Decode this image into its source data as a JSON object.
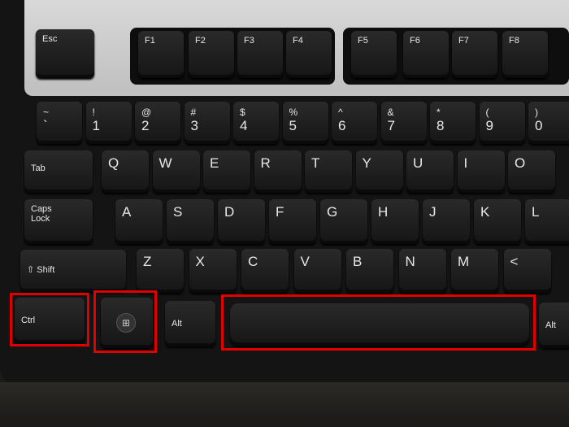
{
  "keyboard": {
    "esc": "Esc",
    "function_keys": [
      "F1",
      "F2",
      "F3",
      "F4",
      "F5",
      "F6",
      "F7",
      "F8"
    ],
    "number_row": [
      {
        "top": "~",
        "bottom": "`"
      },
      {
        "top": "!",
        "bottom": "1"
      },
      {
        "top": "@",
        "bottom": "2"
      },
      {
        "top": "#",
        "bottom": "3"
      },
      {
        "top": "$",
        "bottom": "4"
      },
      {
        "top": "%",
        "bottom": "5"
      },
      {
        "top": "^",
        "bottom": "6"
      },
      {
        "top": "&",
        "bottom": "7"
      },
      {
        "top": "*",
        "bottom": "8"
      },
      {
        "top": "(",
        "bottom": "9"
      },
      {
        "top": ")",
        "bottom": "0"
      }
    ],
    "tab": "Tab",
    "top_row": [
      "Q",
      "W",
      "E",
      "R",
      "T",
      "Y",
      "U",
      "I",
      "O"
    ],
    "caps": "Caps Lock",
    "home_row": [
      "A",
      "S",
      "D",
      "F",
      "G",
      "H",
      "J",
      "K",
      "L"
    ],
    "shift": "Shift",
    "bottom_row": [
      "Z",
      "X",
      "C",
      "V",
      "B",
      "N",
      "M",
      "<"
    ],
    "ctrl": "Ctrl",
    "windows_icon": "windows-logo-icon",
    "alt_left": "Alt",
    "alt_right": "Alt"
  },
  "highlights": {
    "color": "#e00000",
    "targets": [
      "ctrl",
      "windows",
      "space"
    ]
  }
}
